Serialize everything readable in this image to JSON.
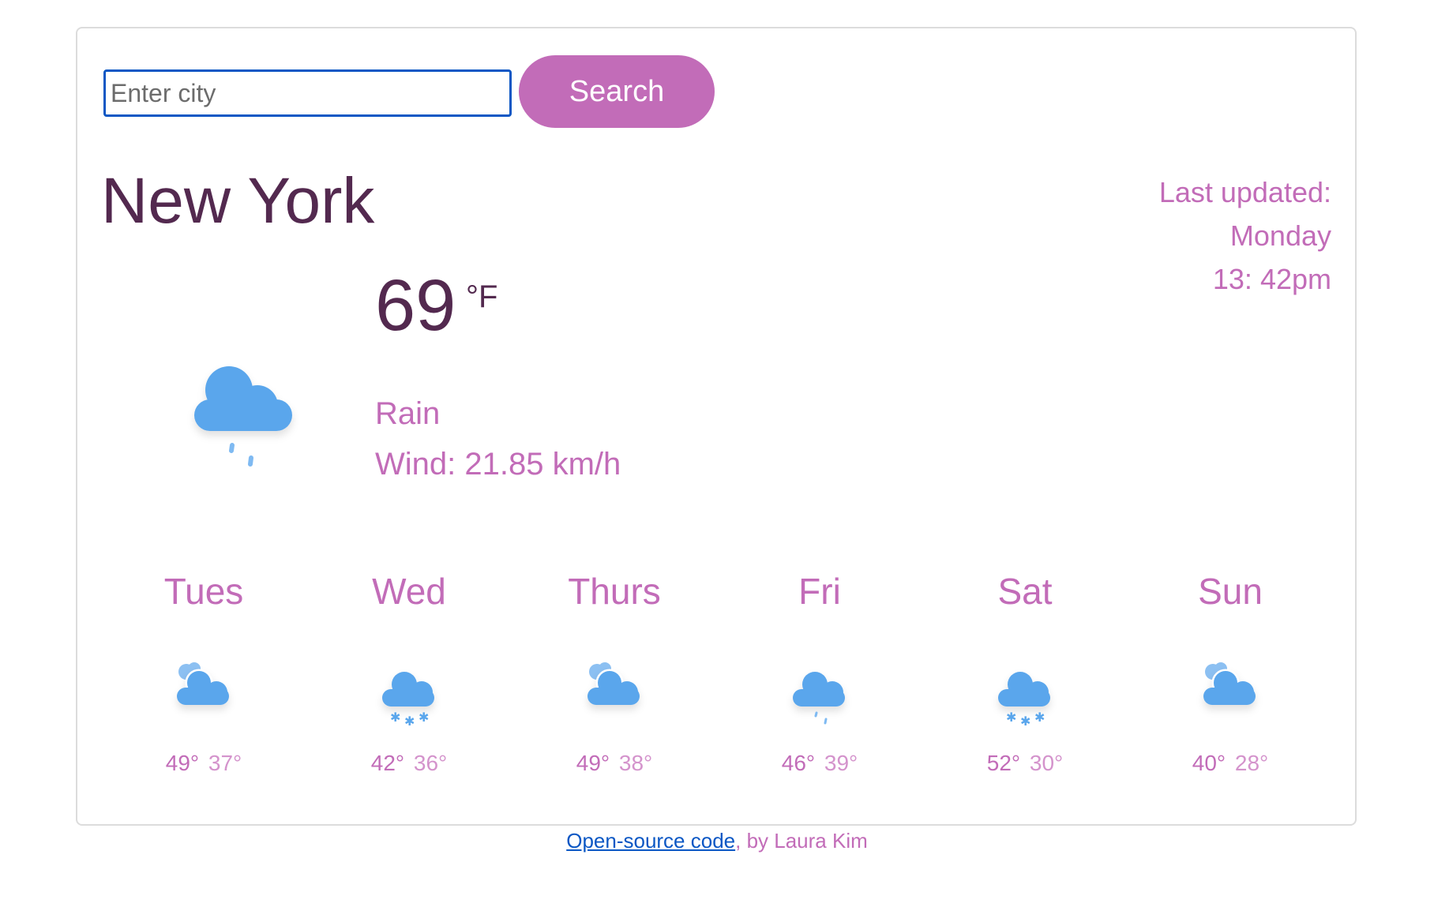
{
  "search": {
    "placeholder": "Enter city",
    "button_label": "Search"
  },
  "current": {
    "city": "New York",
    "temperature": "69",
    "unit": "°F",
    "description": "Rain",
    "wind": "Wind: 21.85 km/h",
    "icon": "rain-icon",
    "last_updated_label": "Last updated:",
    "last_updated_day": "Monday",
    "last_updated_time": "13: 42pm"
  },
  "forecast": [
    {
      "day": "Tues",
      "max": "49°",
      "min": "37°",
      "icon": "partly-cloudy-icon"
    },
    {
      "day": "Wed",
      "max": "42°",
      "min": "36°",
      "icon": "snow-icon"
    },
    {
      "day": "Thurs",
      "max": "49°",
      "min": "38°",
      "icon": "partly-cloudy-icon"
    },
    {
      "day": "Fri",
      "max": "46°",
      "min": "39°",
      "icon": "rain-icon"
    },
    {
      "day": "Sat",
      "max": "52°",
      "min": "30°",
      "icon": "snow-icon"
    },
    {
      "day": "Sun",
      "max": "40°",
      "min": "28°",
      "icon": "partly-cloudy-icon"
    }
  ],
  "footer": {
    "link_text": "Open-source code",
    "suffix": ", by Laura Kim"
  },
  "colors": {
    "accent": "#c26cb8",
    "city_text": "#53294f",
    "input_border": "#0b57c4",
    "cloud": "#5aa6ec"
  }
}
